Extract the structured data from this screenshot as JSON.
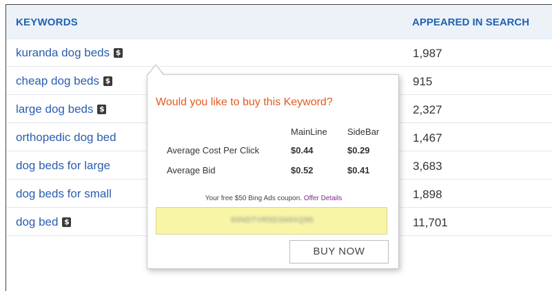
{
  "table": {
    "headers": {
      "keywords": "KEYWORDS",
      "appeared": "APPEARED IN SEARCH"
    },
    "rows": [
      {
        "keyword": "kuranda dog beds",
        "count": "1,987",
        "has_icon": true
      },
      {
        "keyword": "cheap dog beds",
        "count": "915",
        "has_icon": true
      },
      {
        "keyword": "large dog beds",
        "count": "2,327",
        "has_icon": true
      },
      {
        "keyword": "orthopedic dog bed",
        "count": "1,467",
        "has_icon": false
      },
      {
        "keyword": "dog beds for large",
        "count": "3,683",
        "has_icon": false
      },
      {
        "keyword": "dog beds for small",
        "count": "1,898",
        "has_icon": false
      },
      {
        "keyword": "dog bed",
        "count": "11,701",
        "has_icon": true
      }
    ],
    "icon_glyph": "$"
  },
  "popup": {
    "title": "Would you like to buy this Keyword?",
    "col_mainline": "MainLine",
    "col_sidebar": "SideBar",
    "metrics": [
      {
        "label": "Average Cost Per Click",
        "mainline": "$0.44",
        "sidebar": "$0.29"
      },
      {
        "label": "Average Bid",
        "mainline": "$0.52",
        "sidebar": "$0.41"
      }
    ],
    "coupon_text": "Your free $50 Bing Ads coupon.",
    "offer_link": "Offer Details",
    "coupon_code": "94NDTVR5D3A9XQ96",
    "buy_button": "BUY NOW"
  },
  "colors": {
    "link": "#2a5db0",
    "header_text": "#1e62b4",
    "header_bg": "#edf2f8",
    "popup_title": "#e35a1e",
    "coupon_bg": "#f8f6a6",
    "offer_link": "#7a2a8a"
  }
}
